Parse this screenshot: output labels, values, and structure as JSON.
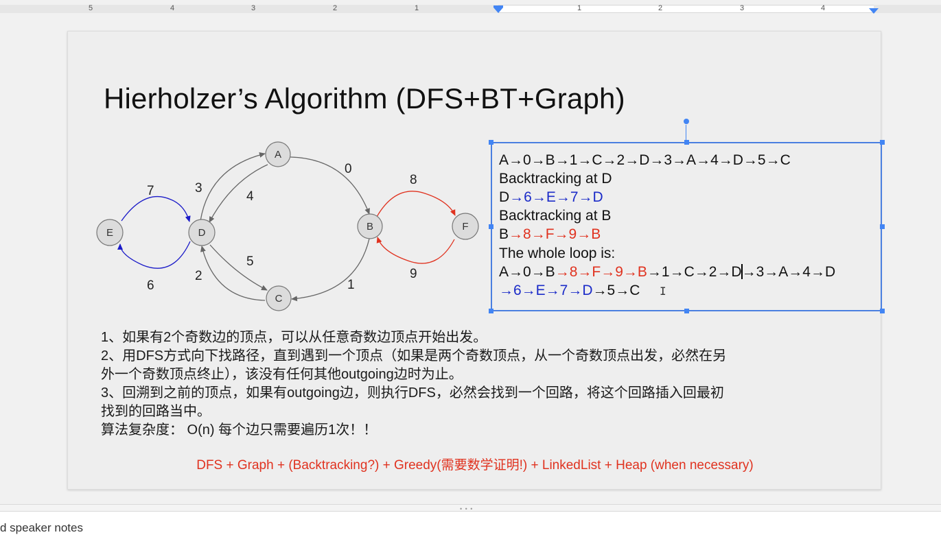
{
  "ruler": {
    "numbers": [
      "5",
      "4",
      "3",
      "2",
      "1",
      "1",
      "2",
      "3",
      "4"
    ]
  },
  "slide": {
    "title": "Hierholzer’s Algorithm (DFS+BT+Graph)",
    "graph": {
      "nodes": [
        "A",
        "B",
        "C",
        "D",
        "E",
        "F"
      ],
      "edge_labels": [
        "0",
        "1",
        "2",
        "3",
        "4",
        "5",
        "6",
        "7",
        "8",
        "9"
      ],
      "colors": {
        "gray_edge": "#666666",
        "blue_edge": "#1a1ac8",
        "red_edge": "#e0321f"
      }
    },
    "textbox": {
      "line1": "A→0→B→1→C→2→D→3→A→4→D→5→C",
      "line2": "Backtracking at D",
      "line3_start": "D",
      "line3_blue": "→6→E→7→D",
      "line4": "Backtracking at B",
      "line5_start": "B",
      "line5_red": "→8→F→9→B",
      "line6": "The whole loop is:",
      "line7_a": "A→0→B",
      "line7_red": "→8→F→9→B",
      "line7_b": "→1→C→2→D",
      "line7_c": "→3→A→4→D",
      "line8_blue": "→6→E→7→D",
      "line8_black": "→5→C"
    },
    "notes_cn": [
      "1、如果有2个奇数边的顶点，可以从任意奇数边顶点开始出发。",
      "2、用DFS方式向下找路径，直到遇到一个顶点（如果是两个奇数顶点，从一个奇数顶点出发，必然在另",
      "外一个奇数顶点终止），该没有任何其他outgoing边时为止。",
      "3、回溯到之前的顶点，如果有outgoing边，则执行DFS，必然会找到一个回路，将这个回路插入回最初",
      "找到的回路当中。",
      "算法复杂度： O(n) 每个边只需要遍历1次！！"
    ],
    "summary": "DFS + Graph + (Backtracking?) + Greedy(需要数学证明!) + LinkedList + Heap (when necessary)"
  },
  "speaker_notes": {
    "placeholder": "d speaker notes"
  }
}
